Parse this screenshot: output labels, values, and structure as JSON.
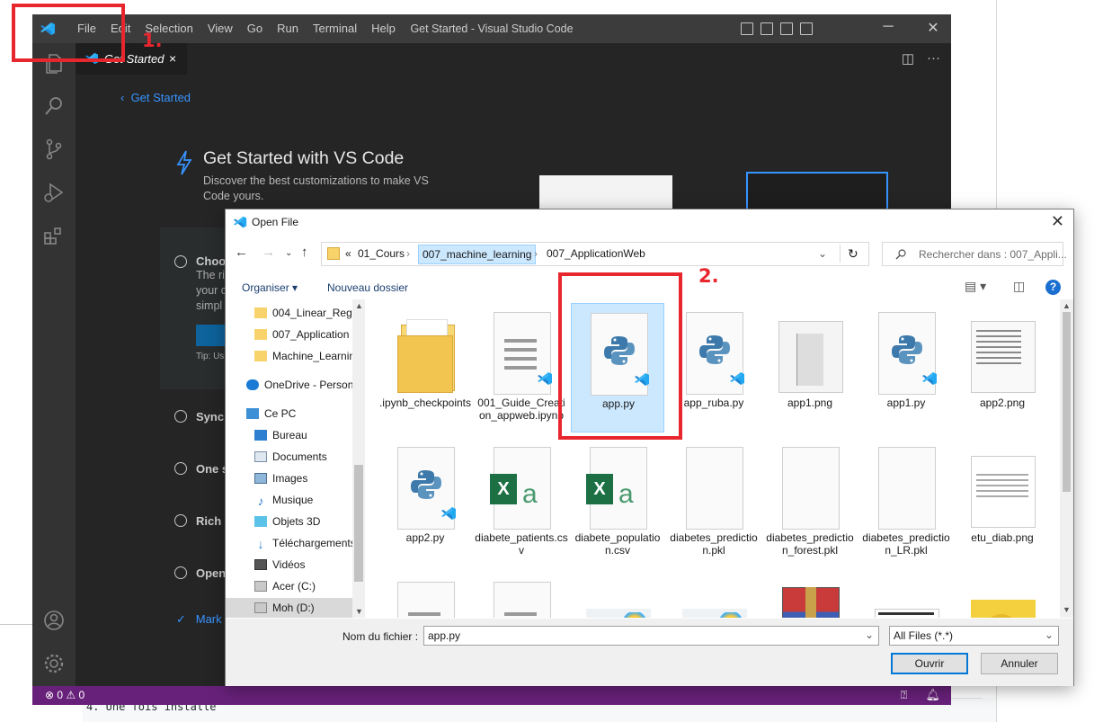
{
  "annotations": {
    "step1": "1.",
    "step2": "2."
  },
  "background": {
    "code_text": "4. Une fois installé"
  },
  "vscode": {
    "window_title": "Get Started - Visual Studio Code",
    "menu": [
      "File",
      "Edit",
      "Selection",
      "View",
      "Go",
      "Run",
      "Terminal",
      "Help"
    ],
    "tab": {
      "label": "Get Started",
      "close": "×"
    },
    "breadcrumb": "Get Started",
    "heading": "Get Started with VS Code",
    "subheading": "Discover the best customizations to make VS Code yours.",
    "steps": [
      "Choo",
      "Sync",
      "One s",
      "Rich",
      "Open"
    ],
    "step_desc": [
      "The ri",
      "your c",
      "simpl"
    ],
    "tip": "Tip: Us",
    "mark": "Mark",
    "status": {
      "errors": "⊗ 0 ⚠ 0"
    },
    "accent": "#68217a"
  },
  "dialog": {
    "title": "Open File",
    "breadcrumb": [
      "«",
      "01_Cours",
      "007_machine_learning",
      "007_ApplicationWeb"
    ],
    "search_placeholder": "Rechercher dans : 007_Appli...",
    "toolbar": {
      "organize": "Organiser ▾",
      "new_folder": "Nouveau dossier"
    },
    "tree": [
      {
        "label": "004_Linear_Regre",
        "icon": "folder-icon"
      },
      {
        "label": "007_Application",
        "icon": "folder-icon"
      },
      {
        "label": "Machine_Learnin",
        "icon": "folder-icon"
      },
      {
        "label": "OneDrive - Person",
        "icon": "cloud-icon"
      },
      {
        "label": "Ce PC",
        "icon": "pc-icon"
      },
      {
        "label": "Bureau",
        "icon": "desktop-icon"
      },
      {
        "label": "Documents",
        "icon": "documents-icon"
      },
      {
        "label": "Images",
        "icon": "images-icon"
      },
      {
        "label": "Musique",
        "icon": "music-icon"
      },
      {
        "label": "Objets 3D",
        "icon": "objects3d-icon"
      },
      {
        "label": "Téléchargements",
        "icon": "downloads-icon"
      },
      {
        "label": "Vidéos",
        "icon": "videos-icon"
      },
      {
        "label": "Acer (C:)",
        "icon": "drive-icon"
      },
      {
        "label": "Moh (D:)",
        "icon": "drive-icon"
      }
    ],
    "files": [
      {
        "name": ".ipynb_checkpoints",
        "icon": "folder"
      },
      {
        "name": "001_Guide_Creation_appweb.ipynb",
        "icon": "doc-vscode"
      },
      {
        "name": "app.py",
        "icon": "python",
        "selected": true
      },
      {
        "name": "app_ruba.py",
        "icon": "python-vscode"
      },
      {
        "name": "app1.png",
        "icon": "image-screenshot"
      },
      {
        "name": "app1.py",
        "icon": "python"
      },
      {
        "name": "app2.png",
        "icon": "image-code"
      },
      {
        "name": "app2.py",
        "icon": "python"
      },
      {
        "name": "diabete_patients.csv",
        "icon": "excel"
      },
      {
        "name": "diabete_population.csv",
        "icon": "excel"
      },
      {
        "name": "diabetes_prediction.pkl",
        "icon": "blank"
      },
      {
        "name": "diabetes_prediction_forest.pkl",
        "icon": "blank"
      },
      {
        "name": "diabetes_prediction_LR.pkl",
        "icon": "blank"
      },
      {
        "name": "etu_diab.png",
        "icon": "image-table"
      },
      {
        "name": "",
        "icon": "doc"
      },
      {
        "name": "",
        "icon": "doc"
      },
      {
        "name": "",
        "icon": "image-splash"
      },
      {
        "name": "",
        "icon": "image-splash"
      },
      {
        "name": "",
        "icon": "winrar"
      },
      {
        "name": "",
        "icon": "image-screen"
      },
      {
        "name": "",
        "icon": "image-pikachu"
      }
    ],
    "filename_label": "Nom du fichier :",
    "filename_value": "app.py",
    "filter": "All Files (*.*)",
    "open_button": "Ouvrir",
    "cancel_button": "Annuler"
  }
}
